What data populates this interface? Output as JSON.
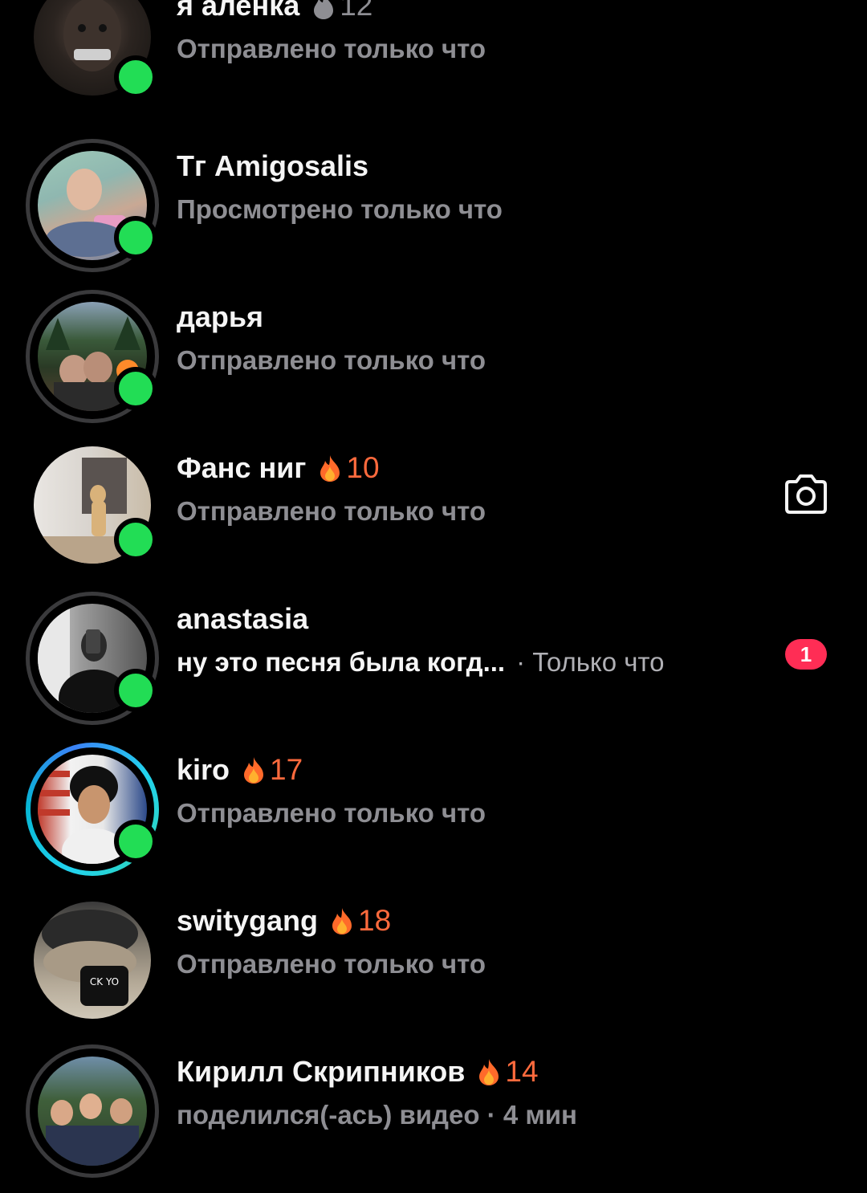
{
  "chats": [
    {
      "name": "я аленка",
      "streak": "12",
      "streak_style": "cold",
      "status": "Отправлено только что",
      "online": true,
      "ring": "none"
    },
    {
      "name": "Тг Amigosalis",
      "streak": "",
      "status": "Просмотрено только что",
      "online": true,
      "ring": "seen"
    },
    {
      "name": "дарья",
      "streak": "",
      "status": "Отправлено только что",
      "online": true,
      "ring": "seen"
    },
    {
      "name": "Фанс ниг",
      "streak": "10",
      "streak_style": "hot",
      "status": "Отправлено только что",
      "online": true,
      "ring": "none",
      "action_icon": "camera-icon"
    },
    {
      "name": "anastasia",
      "streak": "",
      "message": "ну это песня была когд...",
      "time": "· Только что",
      "online": true,
      "ring": "seen",
      "unread": "1"
    },
    {
      "name": "kiro",
      "streak": "17",
      "streak_style": "hot",
      "status": "Отправлено только что",
      "online": true,
      "ring": "story"
    },
    {
      "name": "switygang",
      "streak": "18",
      "streak_style": "hot",
      "status": "Отправлено только что",
      "online": false,
      "ring": "none"
    },
    {
      "name": "Кирилл Скрипников",
      "streak": "14",
      "streak_style": "hot",
      "status": "поделился(-ась) видео · 4 мин",
      "online": false,
      "ring": "seen"
    }
  ],
  "colors": {
    "background": "#000000",
    "online": "#22dd55",
    "streak_hot": "#ff6a3d",
    "badge": "#ff2d55",
    "story_ring": "#22d3ee"
  }
}
